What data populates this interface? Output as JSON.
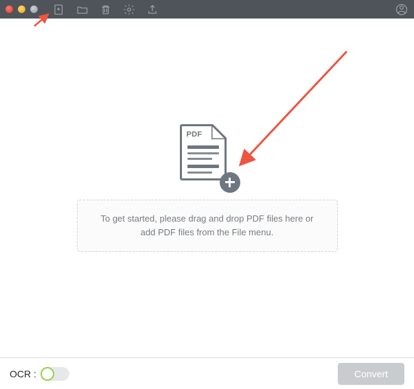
{
  "toolbar": {
    "add_file": "add-file",
    "open_folder": "open-folder",
    "delete": "delete",
    "settings": "settings",
    "export": "export",
    "account": "account"
  },
  "empty_state": {
    "pdf_label": "PDF",
    "message_line1": "To get started, please drag and drop PDF files here or",
    "message_line2": "add PDF files from the File menu."
  },
  "footer": {
    "ocr_label": "OCR :",
    "ocr_enabled": false,
    "convert_label": "Convert"
  },
  "colors": {
    "titlebar": "#4f545a",
    "icon": "#a7acb1",
    "text_muted": "#777c82",
    "ocr_ring": "#9bd04a",
    "convert_disabled": "#c9ccce",
    "arrow": "#ee543f"
  }
}
